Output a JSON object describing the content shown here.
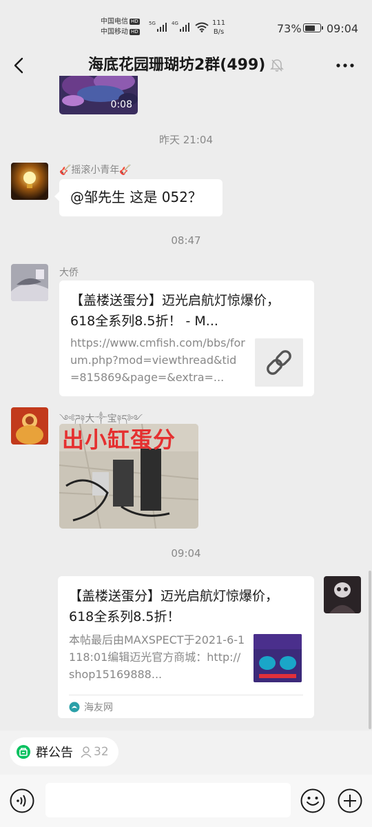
{
  "status_bar": {
    "carrier_1": "中国电信",
    "carrier_2": "中国移动",
    "hd": "HD",
    "signal_1": "5G",
    "signal_2": "4G",
    "net_speed_value": "111",
    "net_speed_unit": "B/s",
    "battery_percent": "73%",
    "battery_level": 0.73,
    "time": "09:04"
  },
  "header": {
    "title": "海底花园珊瑚坊2群(499)",
    "back_icon": "chevron-left-icon",
    "mute_icon": "bell-off-icon",
    "more_icon": "ellipsis-icon"
  },
  "messages": {
    "video": {
      "duration": "0:08"
    },
    "time_1": "昨天 21:04",
    "msg_1": {
      "sender": "🎸摇滚小青年🎸",
      "text": "@邹先生  这是 052？"
    },
    "time_2": "08:47",
    "msg_2": {
      "sender": "大侨",
      "title": "【盖楼送蛋分】迈光启航灯惊爆价，618全系列8.5折！ - M...",
      "url": "https://www.cmfish.com/bbs/forum.php?mod=viewthread&tid=815869&page=&extra=...",
      "link_icon": "link-icon"
    },
    "msg_3": {
      "sender": "༺ཌ༈大༒宝༈ད༻",
      "image_caption": "出小缸蛋分"
    },
    "time_3": "09:04",
    "msg_4": {
      "title": "【盖楼送蛋分】迈光启航灯惊爆价，618全系列8.5折！",
      "desc": "本帖最后由MAXSPECT于2021-6-1118:01编辑迈光官方商城：http://shop15169888...",
      "source": "海友网"
    }
  },
  "bottom": {
    "notice_label": "群公告",
    "member_count": "32",
    "input_placeholder": "",
    "voice_icon": "voice-icon",
    "emoji_icon": "emoji-icon",
    "plus_icon": "plus-icon"
  }
}
